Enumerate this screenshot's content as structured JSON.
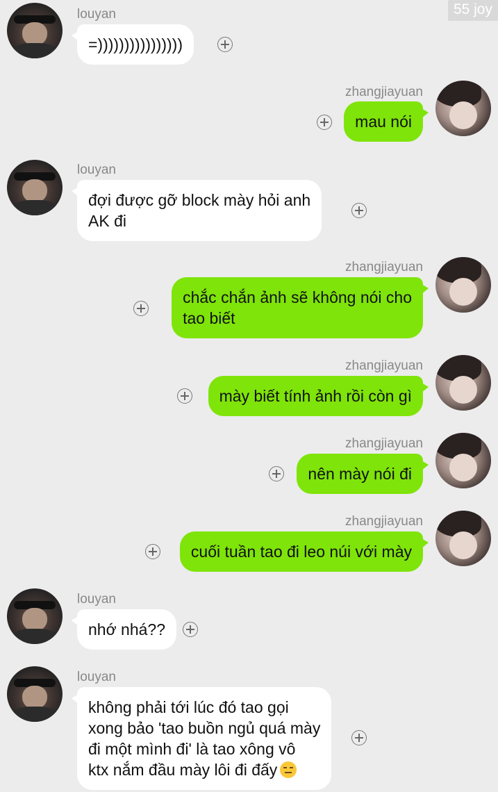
{
  "watermark": "55 joy",
  "colors": {
    "background": "#ececec",
    "incoming_bubble": "#ffffff",
    "outgoing_bubble": "#7fe40a"
  },
  "messages": [
    {
      "sender": "louyan",
      "text": "=))))))))))))))))"
    },
    {
      "sender": "zhangjiayuan",
      "text": "mau nói"
    },
    {
      "sender": "louyan",
      "lines": [
        "đợi được gỡ block mày hỏi anh",
        "AK đi"
      ]
    },
    {
      "sender": "zhangjiayuan",
      "lines": [
        "chắc chắn ảnh sẽ không nói cho",
        "tao biết"
      ]
    },
    {
      "sender": "zhangjiayuan",
      "text": "mày biết tính ảnh rồi còn gì"
    },
    {
      "sender": "zhangjiayuan",
      "text": "nên mày nói đi"
    },
    {
      "sender": "zhangjiayuan",
      "text": "cuối tuần tao đi leo núi với mày"
    },
    {
      "sender": "louyan",
      "text": "nhớ nhá??"
    },
    {
      "sender": "louyan",
      "lines": [
        "không phải tới lúc đó tao gọi",
        "xong bảo 'tao buồn ngủ quá mày",
        "đi một mình đi' là tao xông vô",
        "ktx nắm đầu mày lôi đi đấy"
      ],
      "emoji": "expressionless-face-icon"
    }
  ]
}
